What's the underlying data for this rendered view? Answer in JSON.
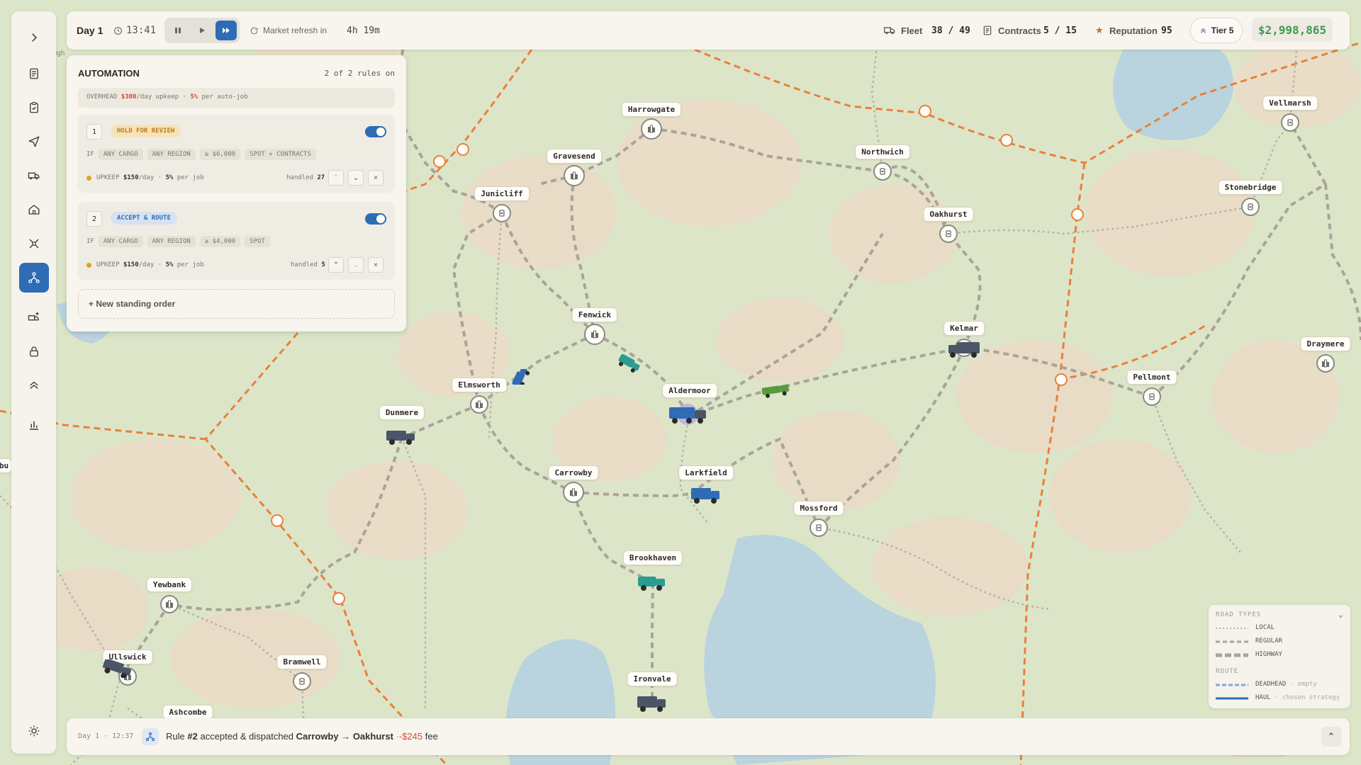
{
  "topbar": {
    "day": "Day 1",
    "time": "13:41",
    "refresh_label": "Market refresh in",
    "refresh_value": "4h 19m",
    "fleet_label": "Fleet",
    "fleet_value": "38 / 49",
    "contracts_label": "Contracts",
    "contracts_value": "5 / 15",
    "reputation_label": "Reputation",
    "reputation_value": "95",
    "tier": "Tier 5",
    "money": "$2,998,865"
  },
  "automation": {
    "title": "AUTOMATION",
    "rules_on": "2 of 2 rules on",
    "overhead_label": "OVERHEAD",
    "overhead_cost": "$300",
    "overhead_unit": "/day upkeep ·",
    "overhead_pct": "5%",
    "overhead_suffix": "per auto-job",
    "if_label": "IF",
    "upkeep_label": "UPKEEP",
    "per_day": "/day ·",
    "per_job": "per job",
    "handled_label": "handled",
    "rules": [
      {
        "index": "1",
        "action": "HOLD FOR REVIEW",
        "cargo": "ANY CARGO",
        "region": "ANY REGION",
        "min": "≥ $6,000",
        "scope": "SPOT + CONTRACTS",
        "upkeep": "$150",
        "pct": "5%",
        "handled": "27",
        "enabled": true
      },
      {
        "index": "2",
        "action": "ACCEPT & ROUTE",
        "cargo": "ANY CARGO",
        "region": "ANY REGION",
        "min": "≥ $4,000",
        "scope": "SPOT",
        "upkeep": "$150",
        "pct": "5%",
        "handled": "5",
        "enabled": true
      }
    ],
    "new_order": "+ New standing order"
  },
  "map": {
    "towns": [
      {
        "name": "Harrowgate",
        "type": "depot"
      },
      {
        "name": "Gravesend",
        "type": "depot"
      },
      {
        "name": "Junicliff",
        "type": "stop"
      },
      {
        "name": "Northwich",
        "type": "stop"
      },
      {
        "name": "Oakhurst",
        "type": "stop"
      },
      {
        "name": "Vellmarsh",
        "type": "stop"
      },
      {
        "name": "Stonebridge",
        "type": "stop"
      },
      {
        "name": "Fenwick",
        "type": "depot"
      },
      {
        "name": "Kelmar",
        "type": "stop"
      },
      {
        "name": "Draymere",
        "type": "depot"
      },
      {
        "name": "Pellmont",
        "type": "stop"
      },
      {
        "name": "Elmsworth",
        "type": "depot"
      },
      {
        "name": "Aldermoor",
        "type": "stop"
      },
      {
        "name": "Dunmere",
        "type": "stop"
      },
      {
        "name": "Carrowby",
        "type": "depot"
      },
      {
        "name": "Larkfield",
        "type": "stop"
      },
      {
        "name": "Mossford",
        "type": "stop"
      },
      {
        "name": "Brookhaven",
        "type": "stop"
      },
      {
        "name": "Yewbank",
        "type": "depot"
      },
      {
        "name": "Ullswick",
        "type": "depot"
      },
      {
        "name": "Bramwell",
        "type": "stop"
      },
      {
        "name": "Ironvale",
        "type": "stop"
      },
      {
        "name": "Ashcombe",
        "type": "stop"
      },
      {
        "name": "Thornbury",
        "type": "stop"
      }
    ],
    "edge_labels": {
      "left_town": "bu",
      "top_left": "igh"
    }
  },
  "legend": {
    "road_types_title": "ROAD TYPES",
    "local": "LOCAL",
    "regular": "REGULAR",
    "highway": "HIGHWAY",
    "route_title": "ROUTE",
    "deadhead": "DEADHEAD",
    "deadhead_note": "· empty",
    "haul": "HAUL",
    "haul_note": "· chosen strategy"
  },
  "bottombar": {
    "timestamp": "Day 1 · 12:37",
    "msg_prefix": "Rule",
    "rule_ref": "#2",
    "msg_mid": "accepted & dispatched",
    "route": "Carrowby → Oakhurst",
    "sep": "·",
    "fee": "-$245",
    "fee_suffix": "fee"
  },
  "colors": {
    "accent": "#2e6cb5",
    "money": "#3f9a52",
    "warning": "#e06a2c",
    "hold_chip_bg": "#f6e3b8",
    "accept_chip_bg": "#d6e2f2"
  }
}
